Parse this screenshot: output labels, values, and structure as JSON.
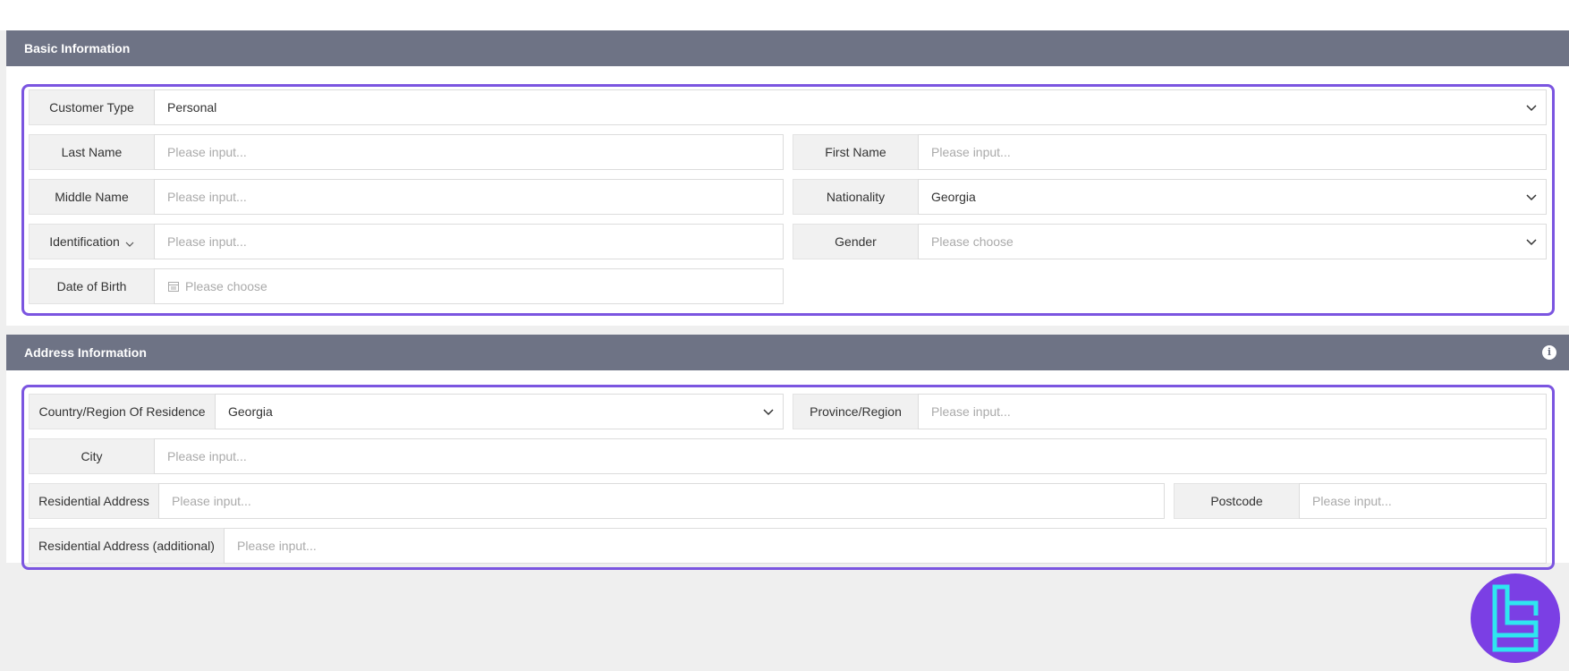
{
  "sections": {
    "basic": {
      "title": "Basic Information"
    },
    "address": {
      "title": "Address Information"
    }
  },
  "basic": {
    "customer_type": {
      "label": "Customer Type",
      "value": "Personal"
    },
    "last_name": {
      "label": "Last Name",
      "placeholder": "Please input..."
    },
    "first_name": {
      "label": "First Name",
      "placeholder": "Please input..."
    },
    "middle_name": {
      "label": "Middle Name",
      "placeholder": "Please input..."
    },
    "nationality": {
      "label": "Nationality",
      "value": "Georgia"
    },
    "identification": {
      "label": "Identification",
      "placeholder": "Please input..."
    },
    "gender": {
      "label": "Gender",
      "placeholder": "Please choose"
    },
    "dob": {
      "label": "Date of Birth",
      "placeholder": "Please choose"
    }
  },
  "address": {
    "country": {
      "label": "Country/Region Of Residence",
      "value": "Georgia"
    },
    "province": {
      "label": "Province/Region",
      "placeholder": "Please input..."
    },
    "city": {
      "label": "City",
      "placeholder": "Please input..."
    },
    "residential": {
      "label": "Residential Address",
      "placeholder": "Please input..."
    },
    "postcode": {
      "label": "Postcode",
      "placeholder": "Please input..."
    },
    "residential_additional": {
      "label": "Residential Address (additional)",
      "placeholder": "Please input..."
    }
  },
  "icons": {
    "chevron": "chevron-down-icon",
    "calendar": "calendar-icon",
    "info": "info-icon",
    "logo": "brand-logo"
  },
  "colors": {
    "header": "#6e7385",
    "frame": "#7b55e0",
    "logo_bg": "#7b3fe4",
    "logo_fg": "#2ee6f0"
  }
}
